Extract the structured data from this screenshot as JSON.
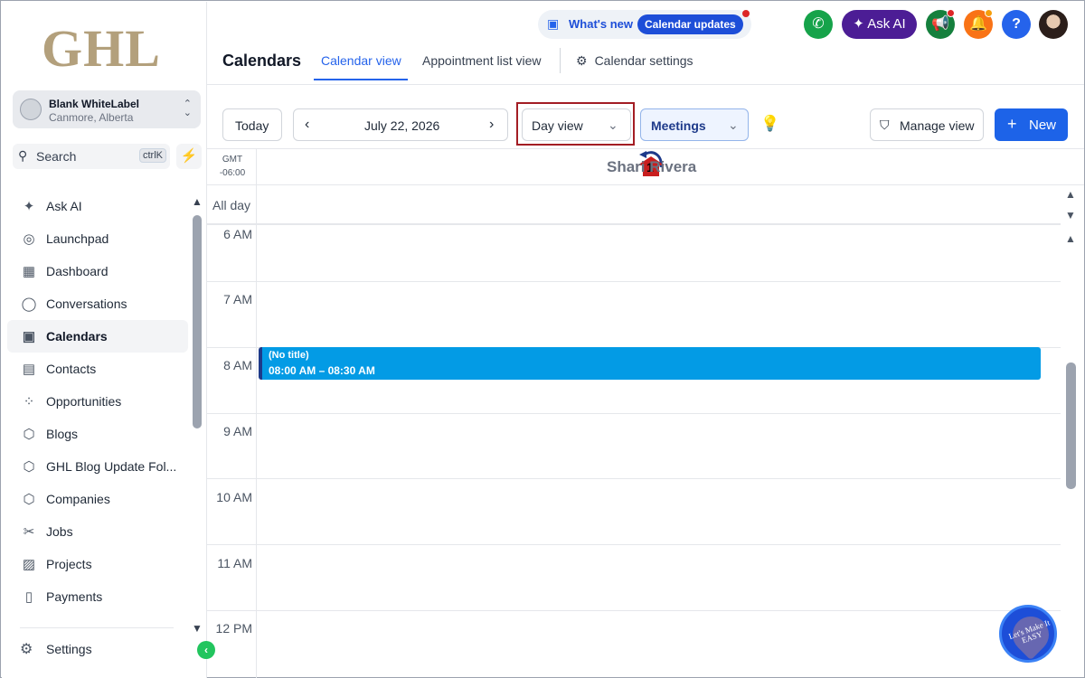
{
  "sidebar": {
    "logo": "GHL",
    "location": {
      "name": "Blank WhiteLabel",
      "place": "Canmore, Alberta"
    },
    "search": {
      "label": "Search",
      "shortcut": "ctrlK"
    },
    "items": [
      {
        "label": "Ask AI",
        "icon": "sparkle-icon"
      },
      {
        "label": "Launchpad",
        "icon": "rocket-icon"
      },
      {
        "label": "Dashboard",
        "icon": "grid-icon"
      },
      {
        "label": "Conversations",
        "icon": "chat-icon"
      },
      {
        "label": "Calendars",
        "icon": "calendar-icon",
        "active": true
      },
      {
        "label": "Contacts",
        "icon": "contacts-icon"
      },
      {
        "label": "Opportunities",
        "icon": "opportunities-icon"
      },
      {
        "label": "Blogs",
        "icon": "cube-icon"
      },
      {
        "label": "GHL Blog Update Fol...",
        "icon": "cube-icon"
      },
      {
        "label": "Companies",
        "icon": "cube-icon"
      },
      {
        "label": "Jobs",
        "icon": "tools-icon"
      },
      {
        "label": "Projects",
        "icon": "projects-icon"
      },
      {
        "label": "Payments",
        "icon": "payments-icon"
      }
    ],
    "settings": "Settings"
  },
  "topbar": {
    "whats_new": "What's new",
    "calendar_updates": "Calendar updates",
    "ask_ai": "Ask AI",
    "help": "?"
  },
  "header": {
    "title": "Calendars",
    "tabs": [
      {
        "label": "Calendar view",
        "active": true
      },
      {
        "label": "Appointment list view"
      },
      {
        "label": "Calendar settings"
      }
    ]
  },
  "toolbar": {
    "today": "Today",
    "date": "July 22, 2026",
    "view": "Day view",
    "filter": "Meetings",
    "manage": "Manage view",
    "new": "New"
  },
  "annotation": {
    "step": "1"
  },
  "calendar": {
    "gmt_label": "GMT",
    "gmt_offset": "-06:00",
    "column": "Shari Rivera",
    "allday": "All day",
    "hours": [
      "6 AM",
      "7 AM",
      "8 AM",
      "9 AM",
      "10 AM",
      "11 AM",
      "12 PM"
    ],
    "event": {
      "title": "(No title)",
      "time": "08:00 AM – 08:30 AM"
    }
  },
  "badge": {
    "text": "Let's Make It EASY"
  },
  "colors": {
    "accent": "#2563eb",
    "event": "#039be5",
    "highlight": "#a31d24"
  }
}
